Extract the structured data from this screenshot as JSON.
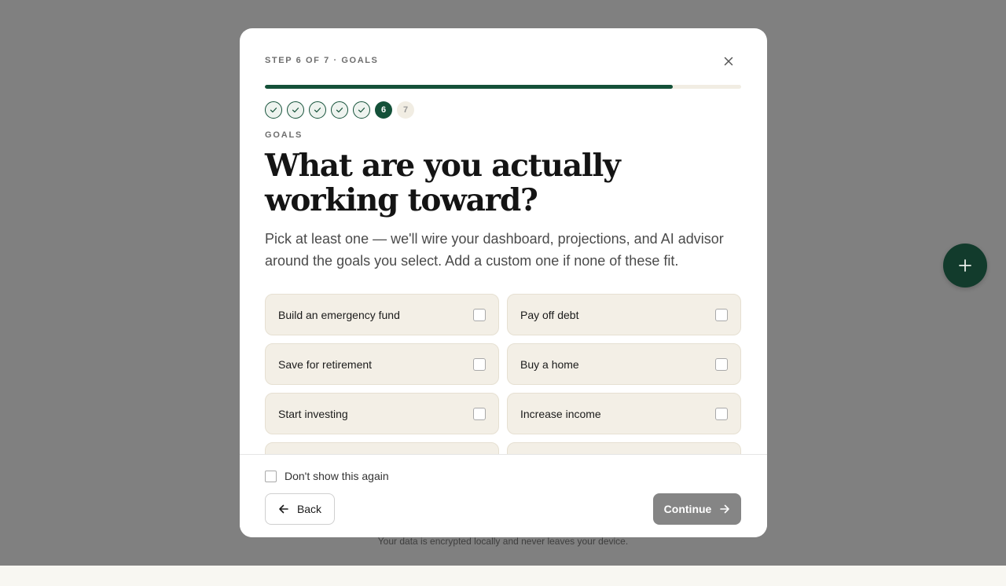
{
  "colors": {
    "accent": "#145139",
    "overlay": "#808080",
    "card_bg": "#f3efe6",
    "continue_disabled": "#858585"
  },
  "fab": {
    "icon": "plus-icon"
  },
  "footnote": "Your data is encrypted locally and never leaves your device.",
  "modal": {
    "step_label": "STEP 6 OF 7 · GOALS",
    "close_icon": "close-icon",
    "progress": {
      "current_step": 6,
      "total_steps": 7,
      "fraction": 0.857
    },
    "steps": [
      {
        "state": "done",
        "label": ""
      },
      {
        "state": "done",
        "label": ""
      },
      {
        "state": "done",
        "label": ""
      },
      {
        "state": "done",
        "label": ""
      },
      {
        "state": "done",
        "label": ""
      },
      {
        "state": "current",
        "label": "6"
      },
      {
        "state": "pending",
        "label": "7"
      }
    ],
    "section_label": "GOALS",
    "title": "What are you actually working toward?",
    "description": "Pick at least one — we'll wire your dashboard, projections, and AI advisor around the goals you select. Add a custom one if none of these fit.",
    "goals": [
      {
        "label": "Build an emergency fund",
        "checked": false
      },
      {
        "label": "Pay off debt",
        "checked": false
      },
      {
        "label": "Save for retirement",
        "checked": false
      },
      {
        "label": "Buy a home",
        "checked": false
      },
      {
        "label": "Start investing",
        "checked": false
      },
      {
        "label": "Increase income",
        "checked": false
      },
      {
        "label": "",
        "checked": false
      },
      {
        "label": "",
        "checked": false
      }
    ],
    "dont_show_label": "Don't show this again",
    "back_label": "Back",
    "continue_label": "Continue"
  }
}
